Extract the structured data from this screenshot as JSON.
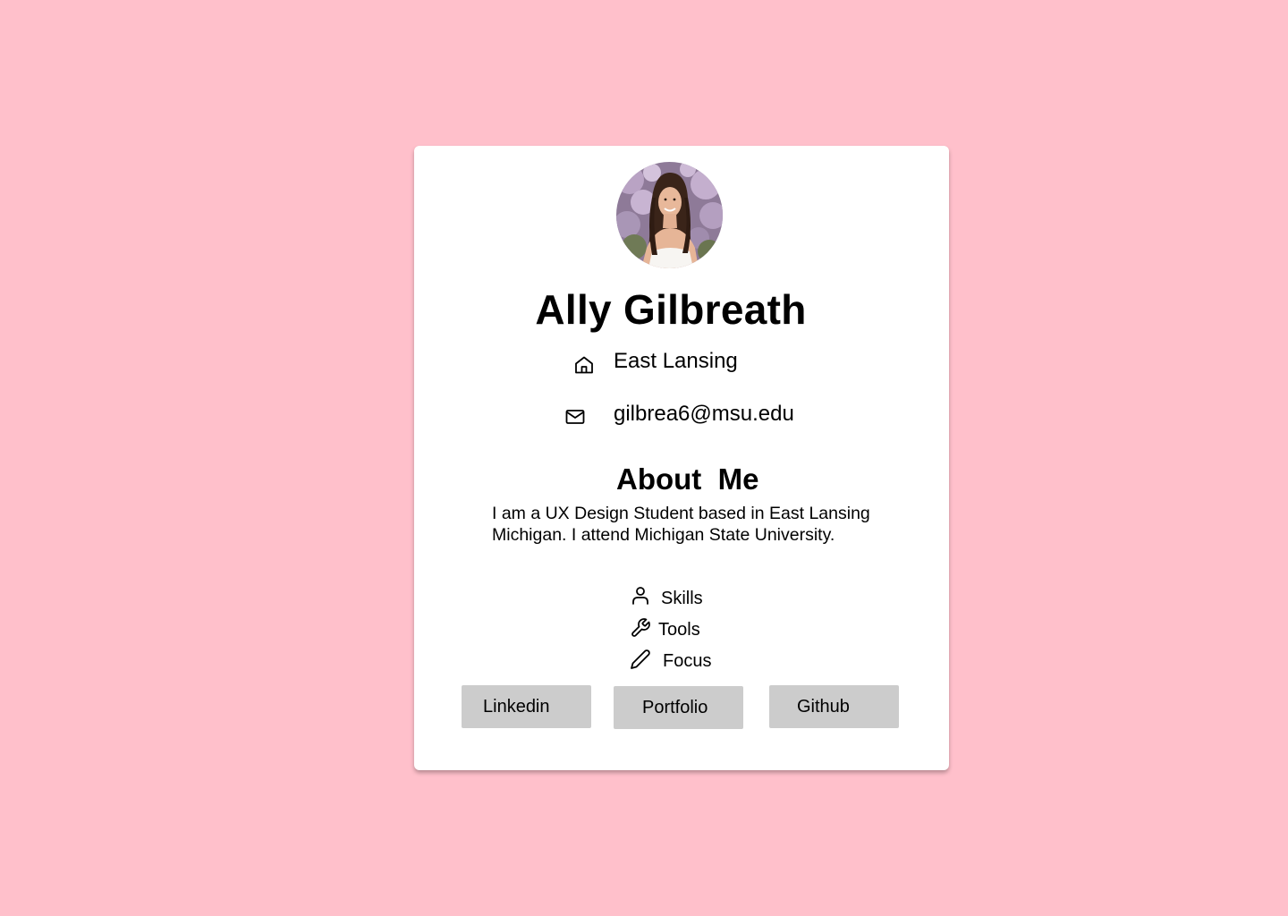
{
  "profile": {
    "name": "Ally Gilbreath",
    "location": "East Lansing",
    "email": "gilbrea6@msu.edu",
    "avatar_alt": "Profile photo"
  },
  "about": {
    "title": "About  Me",
    "body": "I am a UX Design Student based in East Lansing Michigan. I attend Michigan State University."
  },
  "attributes": [
    {
      "label": "Skills",
      "icon": "person-icon"
    },
    {
      "label": "Tools",
      "icon": "wrench-icon"
    },
    {
      "label": "Focus",
      "icon": "pencil-icon"
    }
  ],
  "links": [
    {
      "label": "Linkedin"
    },
    {
      "label": "Portfolio"
    },
    {
      "label": "Github"
    }
  ],
  "colors": {
    "background": "#ffc0cb",
    "card": "#ffffff",
    "button": "#cccccc",
    "text": "#000000"
  }
}
